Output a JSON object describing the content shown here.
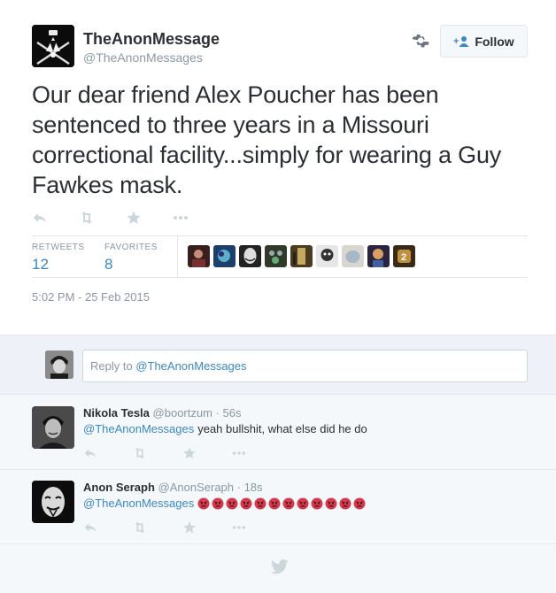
{
  "tweet": {
    "author_name": "TheAnonMessage",
    "author_handle": "@TheAnonMessages",
    "follow_label": "Follow",
    "text": "Our dear friend Alex Poucher has been sentenced to three years in a Missouri correctional facility...simply for wearing a Guy Fawkes mask.",
    "stats": {
      "retweets_label": "RETWEETS",
      "retweets_value": "12",
      "favorites_label": "FAVORITES",
      "favorites_value": "8"
    },
    "favoriters_count_shown": 9,
    "timestamp": "5:02 PM - 25 Feb 2015"
  },
  "reply_box": {
    "placeholder_prefix": "Reply to ",
    "placeholder_mention": "@TheAnonMessages"
  },
  "replies": [
    {
      "name": "Nikola Tesla",
      "handle": "@boortzum",
      "time": "· 56s",
      "mention": "@TheAnonMessages",
      "text": "yeah bullshit, what else did he do"
    },
    {
      "name": "Anon Seraph",
      "handle": "@AnonSeraph",
      "time": "· 18s",
      "mention": "@TheAnonMessages",
      "text": "",
      "emoji": "angry-face",
      "emoji_count": 12
    }
  ],
  "colors": {
    "link": "#3b88c3",
    "muted": "#8899a6",
    "text": "#292f33",
    "border": "#e1e8ed",
    "emoji_red": "#d63a4e"
  },
  "icons": [
    "reply-icon",
    "retweet-icon",
    "favorite-star-icon",
    "more-icon",
    "gear-icon",
    "follow-person-icon",
    "twitter-bird-icon"
  ]
}
